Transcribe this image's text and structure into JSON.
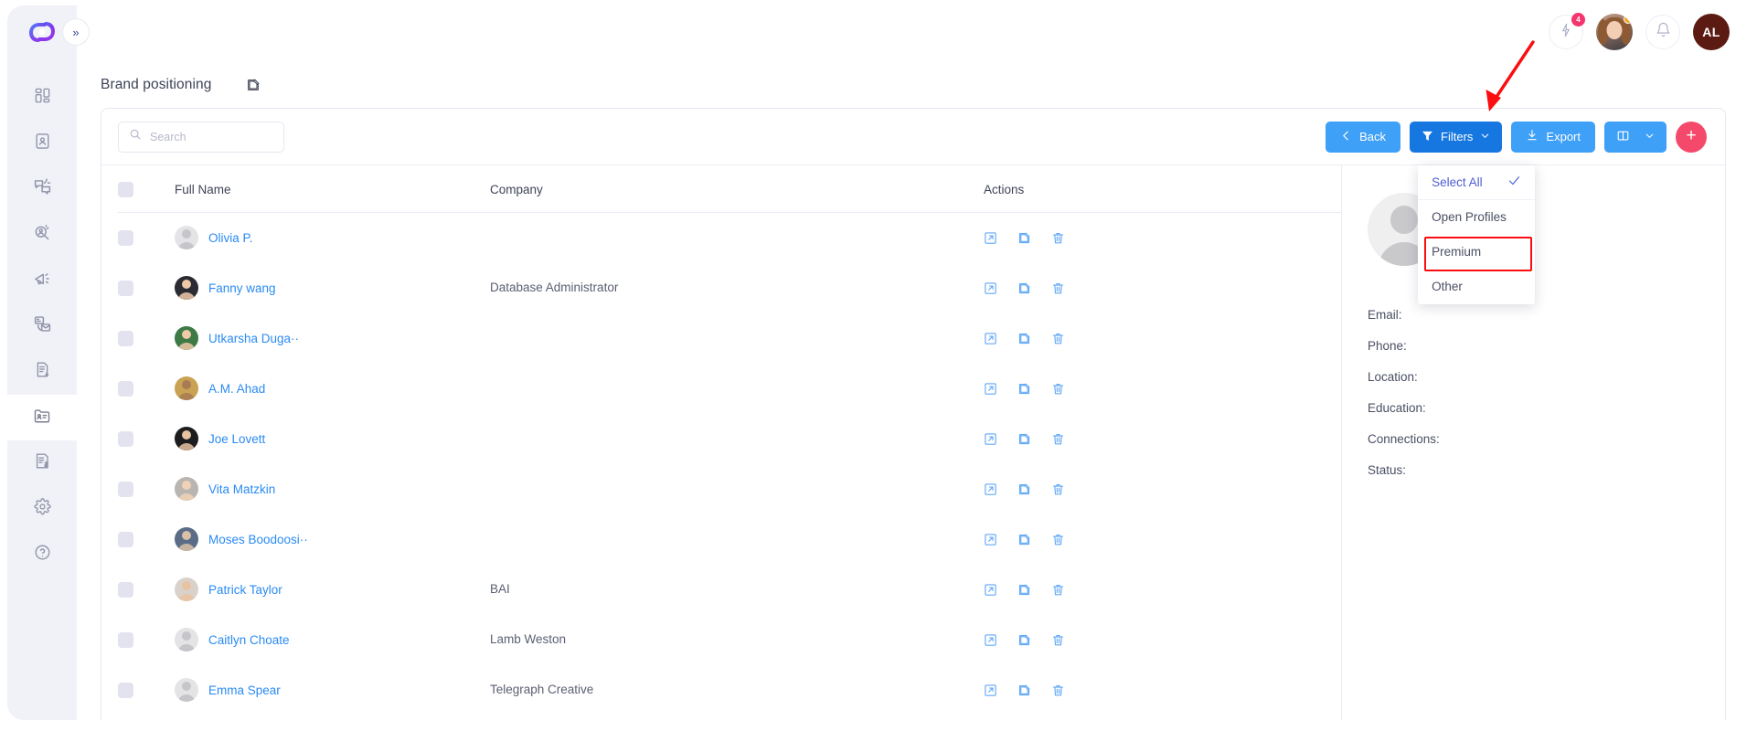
{
  "header": {
    "logo_name": "app-logo",
    "collapse_label": "»",
    "notifications_badge": "4",
    "user_initials": "AL"
  },
  "sidebar": {
    "items": [
      {
        "name": "dashboard",
        "icon": "grid-icon",
        "active": false
      },
      {
        "name": "contacts",
        "icon": "id-card-icon",
        "active": false
      },
      {
        "name": "messages",
        "icon": "chat-bubbles-icon",
        "active": false
      },
      {
        "name": "people-search",
        "icon": "person-search-icon",
        "active": false
      },
      {
        "name": "campaigns",
        "icon": "megaphone-icon",
        "active": false
      },
      {
        "name": "email-sequences",
        "icon": "mail-stack-icon",
        "active": false
      },
      {
        "name": "reports",
        "icon": "document-download-icon",
        "active": false
      },
      {
        "name": "lists",
        "icon": "folder-contacts-icon",
        "active": true
      },
      {
        "name": "billing",
        "icon": "invoice-dollar-icon",
        "active": false
      },
      {
        "name": "settings",
        "icon": "gear-icon",
        "active": false
      },
      {
        "name": "help",
        "icon": "question-circle-icon",
        "active": false
      }
    ]
  },
  "page": {
    "title": "Brand positioning",
    "edit_icon": "edit-square-icon"
  },
  "search": {
    "placeholder": "Search",
    "value": "",
    "icon": "search-icon"
  },
  "toolbar": {
    "back_label": "Back",
    "filters_label": "Filters",
    "export_label": "Export",
    "columns_label": "",
    "add_label": "+",
    "colors": {
      "primary": "#3fa0f7",
      "filters_active": "#1677e0",
      "fab": "#f4496b",
      "annotation": "#fb0d10"
    }
  },
  "filters_dropdown": {
    "open": true,
    "items": [
      {
        "label": "Select All",
        "checked": true,
        "highlighted": false
      },
      {
        "label": "Open Profiles",
        "checked": false,
        "highlighted": false
      },
      {
        "label": "Premium",
        "checked": false,
        "highlighted": true
      },
      {
        "label": "Other",
        "checked": false,
        "highlighted": false
      }
    ]
  },
  "table": {
    "columns": [
      "",
      "Full Name",
      "Company",
      "Actions"
    ],
    "rows": [
      {
        "name": "Olivia P.",
        "company": "",
        "avatar": "placeholder"
      },
      {
        "name": "Fanny wang",
        "company": "Database Administrator",
        "avatar": "photo-1"
      },
      {
        "name": "Utkarsha Duga··",
        "company": "",
        "avatar": "photo-2"
      },
      {
        "name": "A.M. Ahad",
        "company": "",
        "avatar": "photo-3"
      },
      {
        "name": "Joe Lovett",
        "company": "",
        "avatar": "photo-4"
      },
      {
        "name": "Vita Matzkin",
        "company": "",
        "avatar": "photo-5"
      },
      {
        "name": "Moses Boodoosi··",
        "company": "",
        "avatar": "photo-6"
      },
      {
        "name": "Patrick Taylor",
        "company": "BAI",
        "avatar": "photo-7"
      },
      {
        "name": "Caitlyn Choate",
        "company": "Lamb Weston",
        "avatar": "placeholder"
      },
      {
        "name": "Emma Spear",
        "company": "Telegraph Creative",
        "avatar": "placeholder"
      }
    ],
    "row_action_icons": [
      "open-external-icon",
      "edit-icon",
      "delete-icon"
    ]
  },
  "detail": {
    "fields": [
      "Email:",
      "Phone:",
      "Location:",
      "Education:",
      "Connections:",
      "Status:"
    ]
  }
}
